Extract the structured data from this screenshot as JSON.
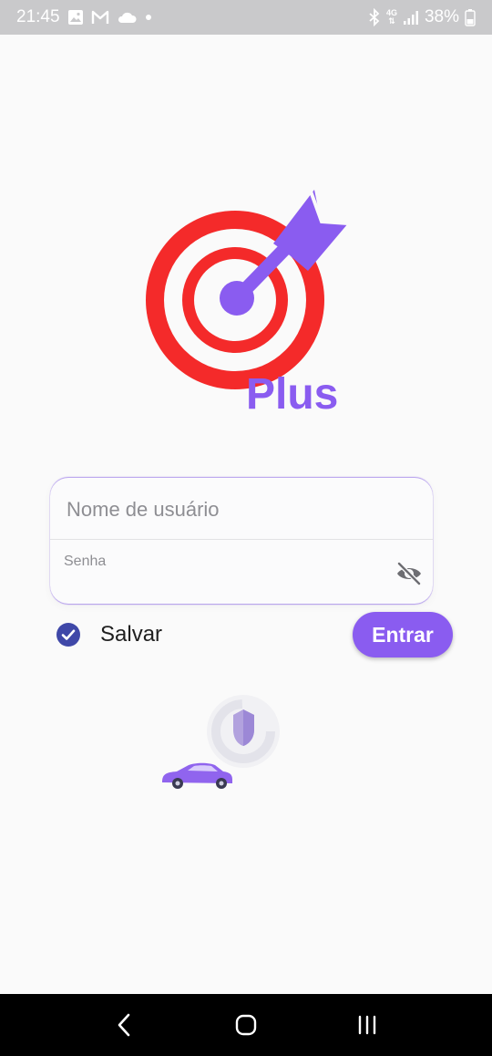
{
  "status_bar": {
    "time": "21:45",
    "network": "4G",
    "battery": "38%",
    "icons": [
      "gallery-icon",
      "gmail-icon",
      "cloud-icon",
      "notification-dot-icon",
      "bluetooth-icon",
      "signal-icon",
      "battery-icon"
    ]
  },
  "logo": {
    "text": "Plus",
    "colors": {
      "ring": "#f42a2a",
      "arrow": "#8a5cf0",
      "text": "#8a5cf0"
    }
  },
  "login": {
    "username_placeholder": "Nome de usuário",
    "username_value": "",
    "password_label": "Senha",
    "password_value": "",
    "password_visibility_icon": "eye-off-icon"
  },
  "save": {
    "label": "Salvar",
    "checked": true
  },
  "enter_button": {
    "label": "Entrar"
  },
  "illustration": {
    "icons": [
      "car-icon",
      "shield-icon"
    ]
  },
  "nav_bar": {
    "icons": [
      "back-icon",
      "home-icon",
      "recents-icon"
    ]
  },
  "colors": {
    "accent": "#8a5cf0",
    "checkbox": "#3f48a8",
    "statusbar": "#c9c9cb"
  }
}
